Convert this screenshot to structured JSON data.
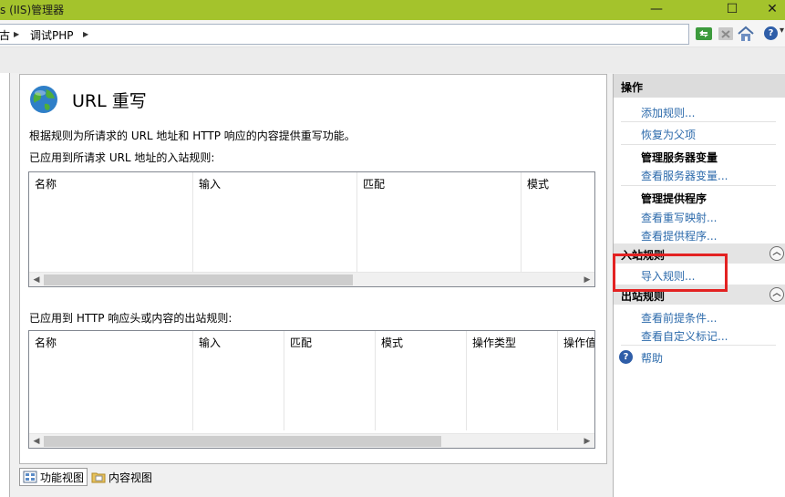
{
  "window": {
    "title": "s (IIS)管理器",
    "minimize_glyph": "—",
    "maximize_glyph": "☐",
    "close_glyph": "✕"
  },
  "addressbar": {
    "crumbs": [
      "古",
      "调试PHP"
    ],
    "separator": "▶",
    "help_glyph": "?",
    "more_glyph": "▾"
  },
  "feature": {
    "title": "URL 重写",
    "description": "根据规则为所请求的 URL 地址和 HTTP 响应的内容提供重写功能。",
    "inbound_label": "已应用到所请求 URL 地址的入站规则:",
    "outbound_label": "已应用到 HTTP 响应头或内容的出站规则:",
    "inbound_columns": [
      "名称",
      "输入",
      "匹配",
      "模式"
    ],
    "outbound_columns": [
      "名称",
      "输入",
      "匹配",
      "模式",
      "操作类型",
      "操作值"
    ]
  },
  "views": {
    "feature_view": "功能视图",
    "content_view": "内容视图"
  },
  "actions": {
    "header": "操作",
    "add_rule": "添加规则...",
    "revert_parent": "恢复为父项",
    "manage_server_vars": "管理服务器变量",
    "view_server_vars": "查看服务器变量...",
    "manage_providers": "管理提供程序",
    "view_rewrite_maps": "查看重写映射...",
    "view_providers": "查看提供程序...",
    "inbound_rules": "入站规则",
    "import_rules": "导入规则...",
    "outbound_rules": "出站规则",
    "view_preconditions": "查看前提条件...",
    "view_custom_tags": "查看自定义标记...",
    "help": "帮助",
    "collapse_glyph": "︿"
  },
  "scroll": {
    "left_glyph": "◀",
    "right_glyph": "▶"
  },
  "colors": {
    "titlebar": "#a4c32c",
    "link": "#2c6aab",
    "highlight": "#e32222"
  }
}
